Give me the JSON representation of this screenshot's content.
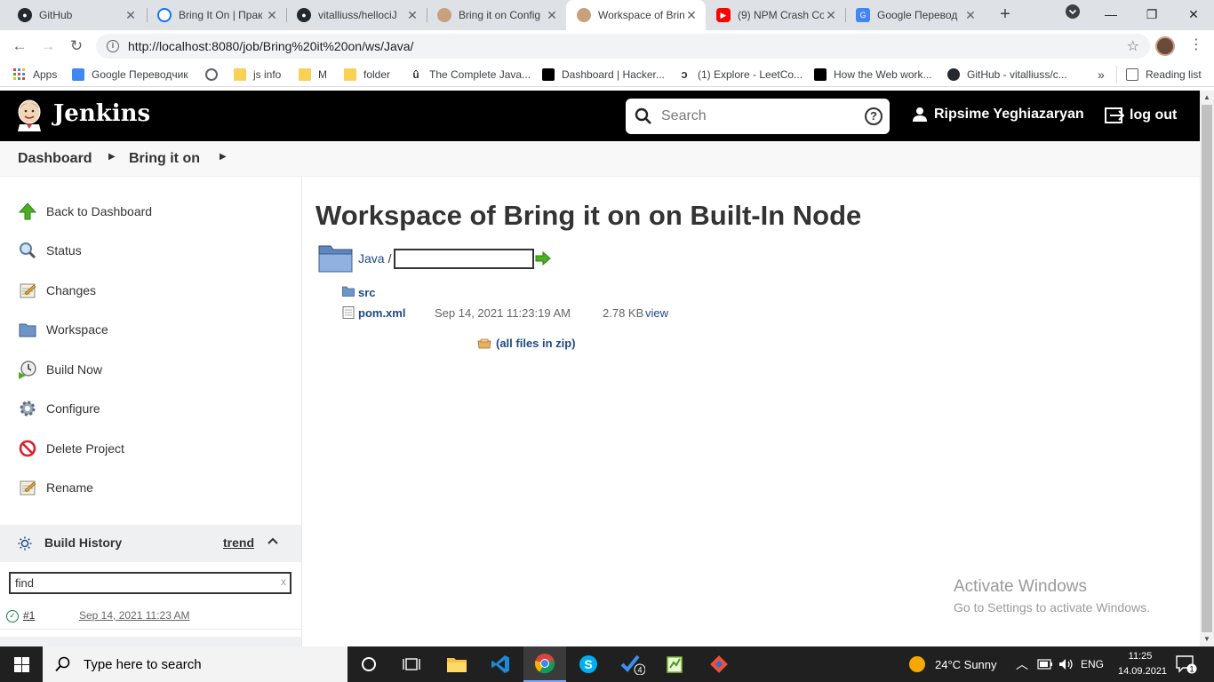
{
  "browser": {
    "tabs": [
      {
        "title": "GitHub",
        "icon": "github-icon",
        "color": "#24292f"
      },
      {
        "title": "Bring It On | Прак",
        "icon": "circle-o-icon",
        "color": "#1a73e8"
      },
      {
        "title": "vitalliuss/hellociJ",
        "icon": "github-icon",
        "color": "#24292f"
      },
      {
        "title": "Bring it on Config",
        "icon": "jenkins-icon",
        "color": "#c7a07e"
      },
      {
        "title": "Workspace of Brin",
        "icon": "jenkins-icon",
        "color": "#c7a07e"
      },
      {
        "title": "(9) NPM Crash Co",
        "icon": "youtube-icon",
        "color": "#ff0000"
      },
      {
        "title": "Google Перевод",
        "icon": "google-translate-icon",
        "color": "#4285f4"
      }
    ],
    "url": "http://localhost:8080/job/Bring%20it%20on/ws/Java/",
    "bookmarks": [
      {
        "label": "Apps",
        "icon": "apps-grid-icon"
      },
      {
        "label": "Google Переводчик",
        "icon": "google-translate-icon"
      },
      {
        "label": "",
        "icon": "globe-icon"
      },
      {
        "label": "js info",
        "icon": "folder-icon"
      },
      {
        "label": "M",
        "icon": "folder-icon"
      },
      {
        "label": "folder",
        "icon": "folder-icon"
      },
      {
        "label": "The Complete Java...",
        "icon": "udemy-icon"
      },
      {
        "label": "Dashboard | Hacker...",
        "icon": "hackerrank-icon"
      },
      {
        "label": "(1) Explore - LeetCo...",
        "icon": "leetcode-icon"
      },
      {
        "label": "How the Web work...",
        "icon": "bookmark-icon"
      },
      {
        "label": "GitHub - vitalliuss/c...",
        "icon": "github-icon"
      }
    ],
    "reading_list": "Reading list",
    "more": "»"
  },
  "jenkins": {
    "brand": "Jenkins",
    "search_placeholder": "Search",
    "user": "Ripsime Yeghiazaryan",
    "logout": "log out",
    "breadcrumb": [
      "Dashboard",
      "Bring it on"
    ],
    "tasks": [
      {
        "label": "Back to Dashboard",
        "icon": "arrow-up-icon"
      },
      {
        "label": "Status",
        "icon": "magnifier-icon"
      },
      {
        "label": "Changes",
        "icon": "notepad-icon"
      },
      {
        "label": "Workspace",
        "icon": "folder-icon"
      },
      {
        "label": "Build Now",
        "icon": "clock-play-icon"
      },
      {
        "label": "Configure",
        "icon": "gear-icon"
      },
      {
        "label": "Delete Project",
        "icon": "no-entry-icon"
      },
      {
        "label": "Rename",
        "icon": "pencil-icon"
      }
    ],
    "build_history": {
      "title": "Build History",
      "trend": "trend",
      "filter_value": "find",
      "builds": [
        {
          "number": "#1",
          "date": "Sep 14, 2021 11:23 AM",
          "status": "success"
        }
      ]
    },
    "page_title": "Workspace of Bring it on on Built-In Node",
    "path": {
      "folder": "Java",
      "separator": "/",
      "input_value": ""
    },
    "files": [
      {
        "name": "src",
        "type": "folder",
        "date": "",
        "size": "",
        "action": ""
      },
      {
        "name": "pom.xml",
        "type": "file",
        "date": "Sep 14, 2021 11:23:19 AM",
        "size": "2.78 KB",
        "action": "view"
      }
    ],
    "zip_link": "(all files in zip)"
  },
  "watermark": {
    "title": "Activate Windows",
    "subtitle": "Go to Settings to activate Windows."
  },
  "taskbar": {
    "search_placeholder": "Type here to search",
    "weather": "24°C  Sunny",
    "language": "ENG",
    "time": "11:25",
    "date": "14.09.2021",
    "notifications": "1",
    "todo_badge": "4"
  }
}
